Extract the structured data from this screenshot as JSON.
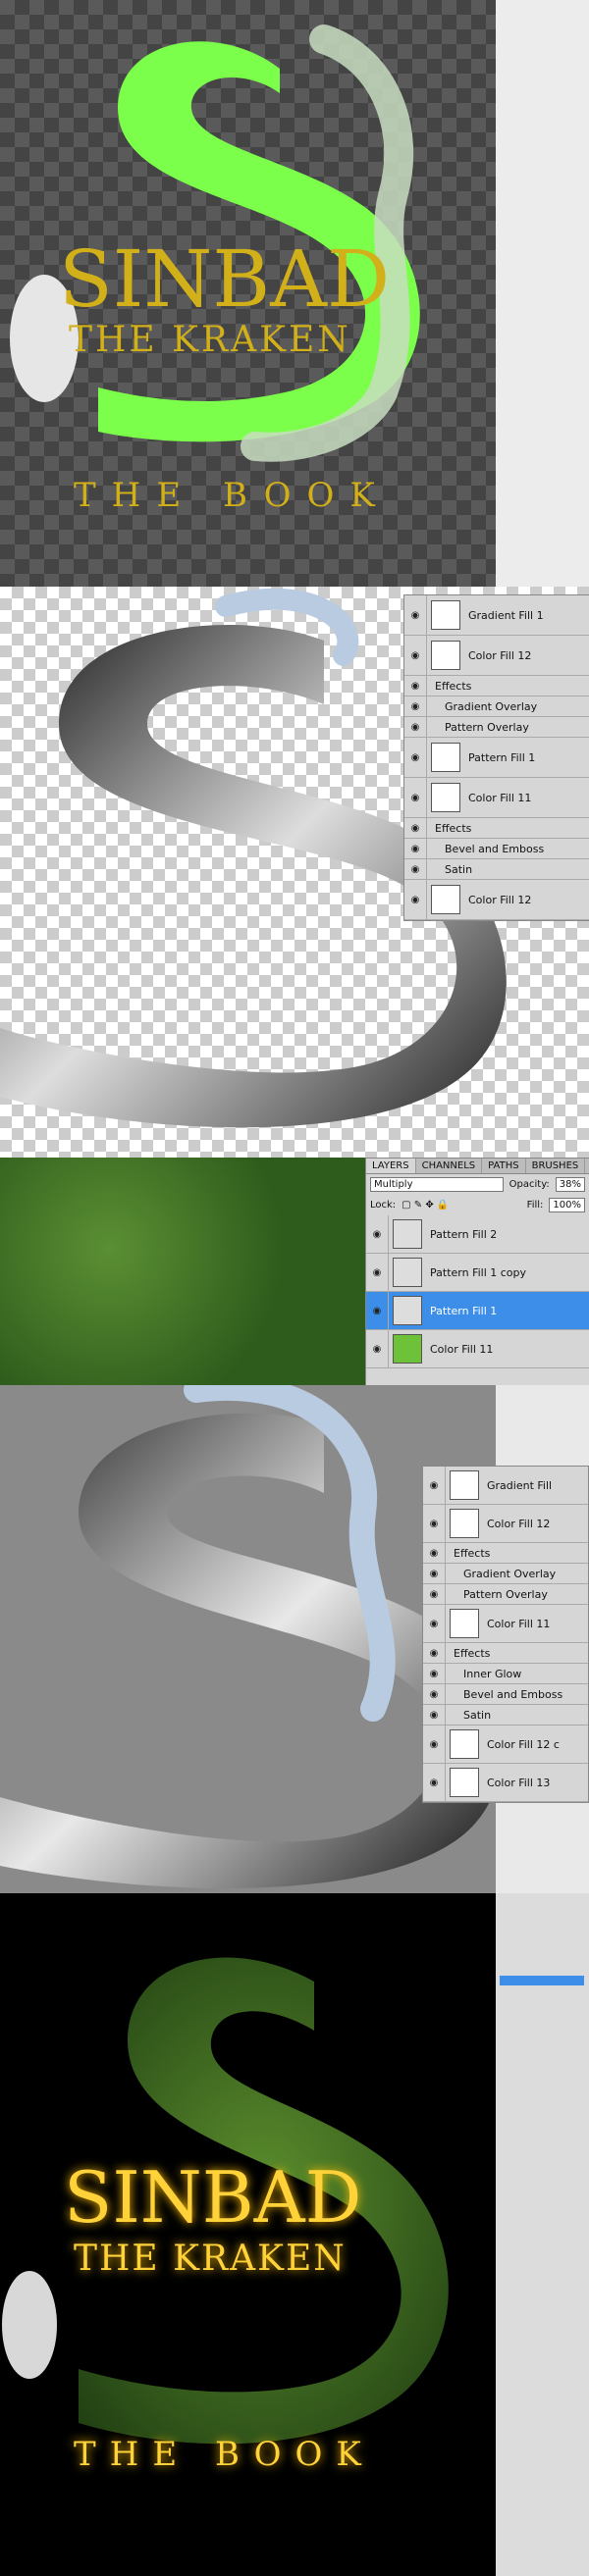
{
  "cover": {
    "title_main": "SINBAD",
    "title_sub": "THE KRAKEN",
    "subtitle": "THE BOOK",
    "title_color": "#d2b01a",
    "body_color": "#7bff4a"
  },
  "panel2_layers": [
    {
      "name": "Gradient Fill 1",
      "type": "layer"
    },
    {
      "name": "Color Fill 12",
      "type": "layer"
    },
    {
      "name": "Effects",
      "type": "effects"
    },
    {
      "name": "Gradient Overlay",
      "type": "effect"
    },
    {
      "name": "Pattern Overlay",
      "type": "effect"
    },
    {
      "name": "Pattern Fill 1",
      "type": "layer"
    },
    {
      "name": "Color Fill 11",
      "type": "layer"
    },
    {
      "name": "Effects",
      "type": "effects"
    },
    {
      "name": "Bevel and Emboss",
      "type": "effect"
    },
    {
      "name": "Satin",
      "type": "effect"
    },
    {
      "name": "Color Fill 12",
      "type": "layer"
    }
  ],
  "layers_panel": {
    "tabs": [
      "LAYERS",
      "CHANNELS",
      "PATHS",
      "BRUSHES"
    ],
    "blend_mode": "Multiply",
    "opacity_label": "Opacity:",
    "opacity_value": "38%",
    "lock_label": "Lock:",
    "fill_label": "Fill:",
    "fill_value": "100%",
    "layers": [
      "Pattern Fill 2",
      "Pattern Fill 1 copy",
      "Pattern Fill 1",
      "Color Fill 11"
    ]
  },
  "panel4_layers": [
    {
      "name": "Gradient Fill",
      "type": "layer"
    },
    {
      "name": "Color Fill 12",
      "type": "layer"
    },
    {
      "name": "Effects",
      "type": "effects"
    },
    {
      "name": "Gradient Overlay",
      "type": "effect"
    },
    {
      "name": "Pattern Overlay",
      "type": "effect"
    },
    {
      "name": "Color Fill 11",
      "type": "layer"
    },
    {
      "name": "Effects",
      "type": "effects"
    },
    {
      "name": "Inner Glow",
      "type": "effect"
    },
    {
      "name": "Bevel and Emboss",
      "type": "effect"
    },
    {
      "name": "Satin",
      "type": "effect"
    },
    {
      "name": "Color Fill 12 c",
      "type": "layer"
    },
    {
      "name": "Color Fill 13",
      "type": "layer"
    }
  ],
  "final": {
    "title_main": "SINBAD",
    "title_sub": "THE KRAKEN",
    "subtitle": "THE BOOK",
    "glow_color": "#ffd23a"
  }
}
